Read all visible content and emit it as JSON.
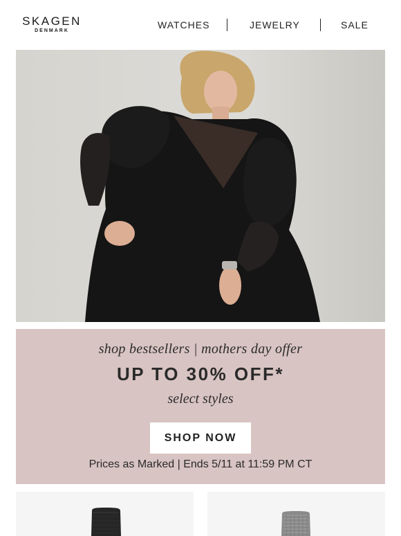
{
  "brand": {
    "name": "SKAGEN",
    "sub": "DENMARK"
  },
  "nav": {
    "items": [
      {
        "label": "WATCHES"
      },
      {
        "label": "JEWELRY"
      },
      {
        "label": "SALE"
      }
    ]
  },
  "promo": {
    "subtitle": "shop bestsellers | mothers day offer",
    "headline": "UP TO 30% OFF*",
    "qualifier": "select styles",
    "cta": "SHOP NOW",
    "note": "Prices as Marked | Ends 5/11 at 11:59 PM CT",
    "background": "#d8c4c2"
  },
  "colors": {
    "accent": "#d8c4c2",
    "text": "#222222",
    "tile": "#f5f5f5"
  },
  "products": [
    {
      "icon": "black-mesh-watch-strap-icon"
    },
    {
      "icon": "silver-mesh-watch-strap-icon"
    }
  ]
}
